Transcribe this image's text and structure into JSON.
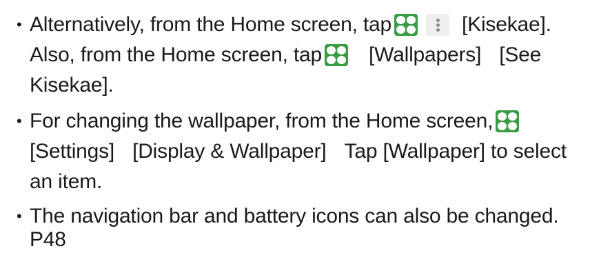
{
  "items": [
    {
      "lines": [
        {
          "a": "Alternatively, from the Home screen, tap",
          "b": "[Kisekae]."
        },
        {
          "a": "Also, from the Home screen, tap",
          "b": "[Wallpapers]",
          "c": "[See"
        },
        {
          "a": "Kisekae]."
        }
      ]
    },
    {
      "lines": [
        {
          "a": "For changing the wallpaper, from the Home screen,"
        },
        {
          "a": "[Settings]",
          "b": "[Display & Wallpaper]",
          "c": "Tap [Wallpaper] to select"
        },
        {
          "a": "an item."
        }
      ]
    },
    {
      "lines": [
        {
          "a": "The navigation bar and battery icons can also be changed."
        },
        {
          "a": "P48"
        }
      ]
    }
  ],
  "bullet_char": "•",
  "icons": {
    "apps": "apps-icon",
    "more": "more-vertical-icon"
  },
  "colors": {
    "apps_icon": "#3a9d45",
    "text": "#1a1a1a"
  }
}
